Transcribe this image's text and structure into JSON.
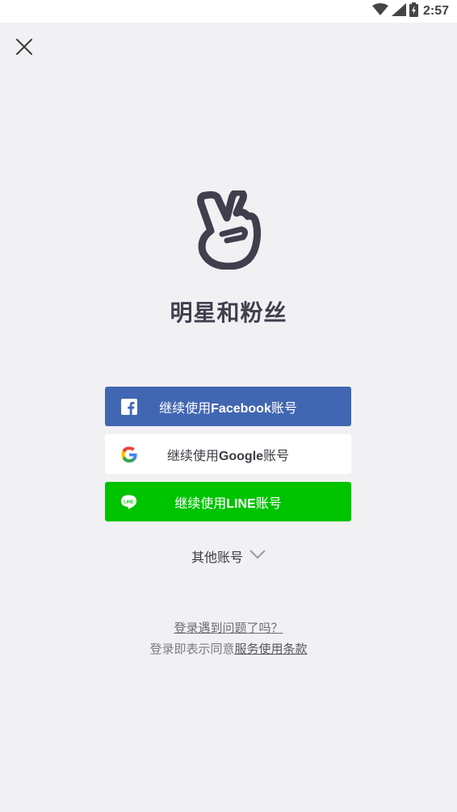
{
  "status_bar": {
    "time": "2:57",
    "icons": [
      "wifi-icon",
      "signal-icon",
      "battery-icon"
    ]
  },
  "header": {
    "close_icon": "close-icon"
  },
  "app": {
    "logo_icon": "v-hand-logo-icon",
    "title": "明星和粉丝"
  },
  "login": {
    "facebook": {
      "icon": "facebook-icon",
      "prefix": "继续使用",
      "brand": "Facebook",
      "suffix": "账号",
      "color": "#4267b2"
    },
    "google": {
      "icon": "google-icon",
      "prefix": "继续使用",
      "brand": "Google",
      "suffix": "账号",
      "color": "#ffffff"
    },
    "line": {
      "icon": "line-icon",
      "prefix": "继续使用",
      "brand": "LINE",
      "suffix": "账号",
      "color": "#00c300"
    },
    "other_accounts": "其他账号"
  },
  "footer": {
    "trouble": "登录遇到问题了吗？",
    "terms_prefix": "登录即表示同意",
    "terms_link": "服务使用条款"
  }
}
